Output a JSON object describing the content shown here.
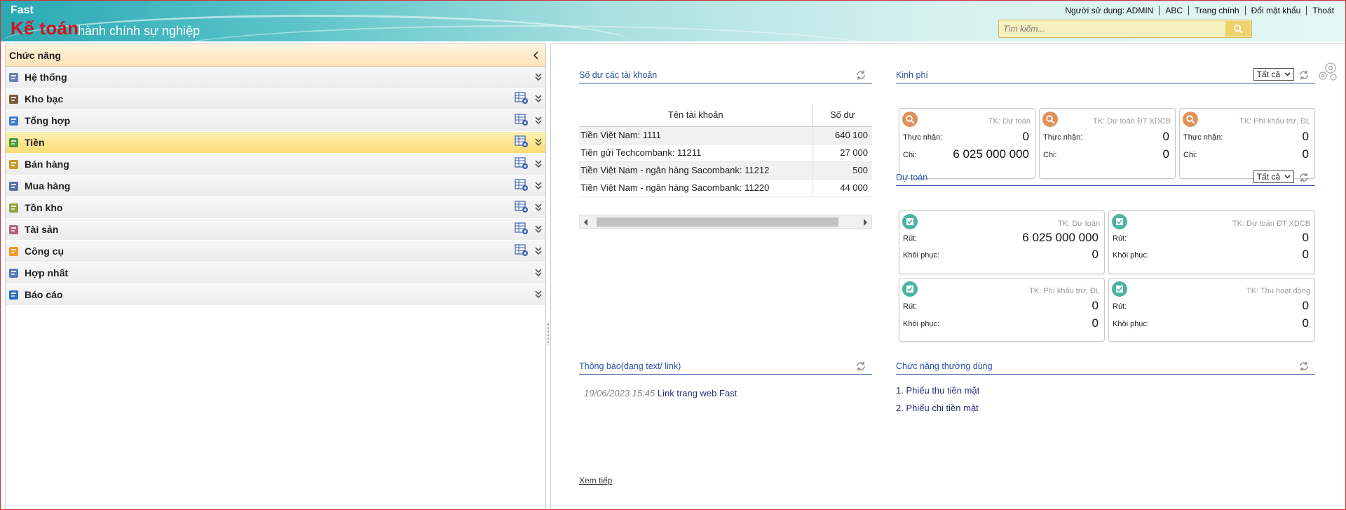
{
  "header": {
    "logo_top": "Fast",
    "logo_main": "Kế toán",
    "logo_sub": "hành chính sự nghiệp",
    "nav": [
      "Người sử dụng: ADMIN",
      "ABC",
      "Trang chính",
      "Đổi mật khẩu",
      "Thoát"
    ],
    "search_placeholder": "Tìm kiếm..."
  },
  "sidebar": {
    "title": "Chức năng",
    "items": [
      {
        "label": "Hệ thống",
        "icon": "system-icon",
        "grid": false,
        "active": false
      },
      {
        "label": "Kho bạc",
        "icon": "treasury-icon",
        "grid": true,
        "active": false
      },
      {
        "label": "Tổng hợp",
        "icon": "summary-icon",
        "grid": true,
        "active": false
      },
      {
        "label": "Tiền",
        "icon": "money-icon",
        "grid": true,
        "active": true
      },
      {
        "label": "Bán hàng",
        "icon": "sales-icon",
        "grid": true,
        "active": false
      },
      {
        "label": "Mua hàng",
        "icon": "purchase-icon",
        "grid": true,
        "active": false
      },
      {
        "label": "Tồn kho",
        "icon": "inventory-icon",
        "grid": true,
        "active": false
      },
      {
        "label": "Tài sản",
        "icon": "assets-icon",
        "grid": true,
        "active": false
      },
      {
        "label": "Công cụ",
        "icon": "tools-icon",
        "grid": true,
        "active": false
      },
      {
        "label": "Hợp nhất",
        "icon": "consolidate-icon",
        "grid": false,
        "active": false
      },
      {
        "label": "Báo cáo",
        "icon": "report-icon",
        "grid": false,
        "active": false
      }
    ]
  },
  "balances": {
    "title": "Số dư các tài khoản",
    "col_name": "Tên tài khoản",
    "col_balance": "Số dư",
    "rows": [
      {
        "name": "Tiền Việt Nam: 1111",
        "balance": "640 100"
      },
      {
        "name": "Tiền gửi Techcombank: 11211",
        "balance": "27 000"
      },
      {
        "name": "Tiền Việt Nam - ngân hàng Sacombank: 11212",
        "balance": "500"
      },
      {
        "name": "Tiền Việt Nam - ngân hàng Sacombank: 11220",
        "balance": "44 000"
      }
    ]
  },
  "funding": {
    "title": "Kinh phí",
    "filter": "Tất cả",
    "cards": [
      {
        "tk": "TK: Dự toán",
        "l1": "Thực nhận:",
        "v1": "0",
        "l2": "Chi:",
        "v2": "6 025 000 000"
      },
      {
        "tk": "TK: Dự toán ĐT XDCB",
        "l1": "Thực nhận:",
        "v1": "0",
        "l2": "Chi:",
        "v2": "0"
      },
      {
        "tk": "TK: Phí khấu trừ, ĐL",
        "l1": "Thực nhận:",
        "v1": "0",
        "l2": "Chi:",
        "v2": "0"
      }
    ]
  },
  "estimate": {
    "title": "Dự toán",
    "filter": "Tất cả",
    "cards": [
      {
        "tk": "TK: Dự toán",
        "l1": "Rút:",
        "v1": "6 025 000 000",
        "l2": "Khôi phục:",
        "v2": "0"
      },
      {
        "tk": "TK: Dự toán ĐT XDCB",
        "l1": "Rút:",
        "v1": "0",
        "l2": "Khôi phục:",
        "v2": "0"
      },
      {
        "tk": "TK: Phí khấu trừ, ĐL",
        "l1": "Rút:",
        "v1": "0",
        "l2": "Khôi phục:",
        "v2": "0"
      },
      {
        "tk": "TK: Thu hoạt động",
        "l1": "Rút:",
        "v1": "0",
        "l2": "Khôi phục:",
        "v2": "0"
      }
    ]
  },
  "notices": {
    "title": "Thông báo(dạng text/ link)",
    "date": "19/06/2023 15:45",
    "link": "Link trang web Fast",
    "more": "Xem tiếp"
  },
  "favorites": {
    "title": "Chức năng thường dùng",
    "items": [
      "1. Phiếu thu tiền mặt",
      "2. Phiếu chi tiền mặt"
    ]
  }
}
